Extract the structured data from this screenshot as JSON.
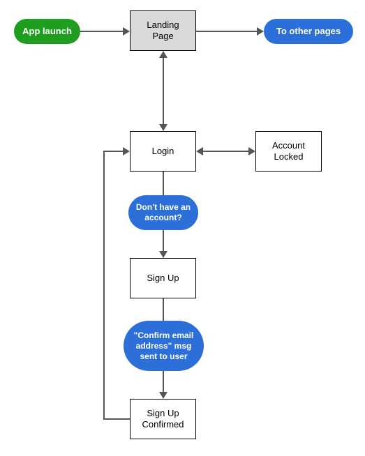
{
  "nodes": {
    "app_launch": {
      "label": "App launch",
      "shape": "pill",
      "color": "green"
    },
    "landing_page": {
      "label": "Landing Page",
      "shape": "rect",
      "shaded": true
    },
    "to_other": {
      "label": "To other pages",
      "shape": "pill",
      "color": "blue"
    },
    "login": {
      "label": "Login",
      "shape": "rect"
    },
    "account_locked": {
      "label": "Account Locked",
      "shape": "rect"
    },
    "no_account": {
      "label": "Don't have an account?",
      "shape": "pill",
      "color": "blue"
    },
    "sign_up": {
      "label": "Sign Up",
      "shape": "rect"
    },
    "confirm_msg": {
      "label": "\"Confirm email address\" msg sent to user",
      "shape": "pill",
      "color": "blue"
    },
    "sign_up_confirmed": {
      "label": "Sign Up Confirmed",
      "shape": "rect"
    }
  },
  "edges": [
    {
      "from": "app_launch",
      "to": "landing_page",
      "bidir": false
    },
    {
      "from": "landing_page",
      "to": "to_other",
      "bidir": false
    },
    {
      "from": "landing_page",
      "to": "login",
      "bidir": true
    },
    {
      "from": "login",
      "to": "account_locked",
      "bidir": true
    },
    {
      "from": "login",
      "to": "no_account",
      "bidir": false
    },
    {
      "from": "no_account",
      "to": "sign_up",
      "bidir": false
    },
    {
      "from": "sign_up",
      "to": "confirm_msg",
      "bidir": false
    },
    {
      "from": "confirm_msg",
      "to": "sign_up_confirmed",
      "bidir": false
    },
    {
      "from": "sign_up_confirmed",
      "to": "login",
      "bidir": false,
      "route": "left-up"
    }
  ]
}
